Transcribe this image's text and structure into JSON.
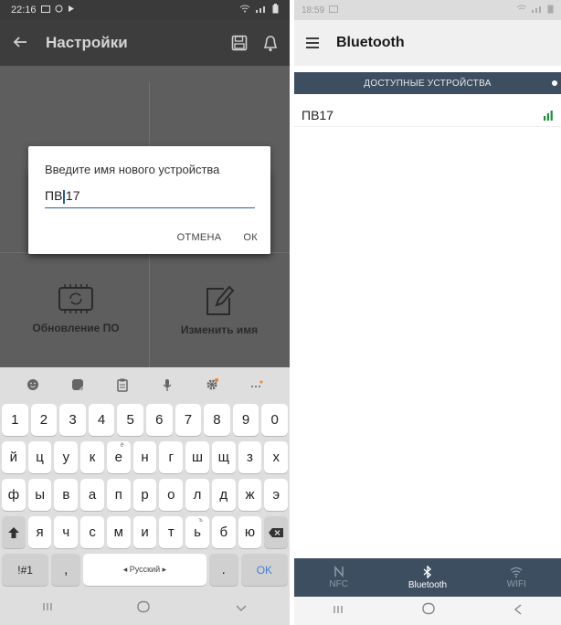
{
  "left": {
    "status": {
      "time": "22:16"
    },
    "appbar": {
      "title": "Настройки"
    },
    "dialog": {
      "title": "Введите имя нового устройства",
      "input_value_before_caret": "ПВ",
      "input_value_after_caret": "17",
      "cancel_label": "ОТМЕНА",
      "ok_label": "ОК"
    },
    "tiles": [
      {
        "label": "Обновление ПО",
        "icon": "firmware-chip-icon"
      },
      {
        "label": "Изменить имя",
        "icon": "edit-name-icon"
      }
    ],
    "keyboard": {
      "row_numbers": [
        "1",
        "2",
        "3",
        "4",
        "5",
        "6",
        "7",
        "8",
        "9",
        "0"
      ],
      "row1": [
        "й",
        "ц",
        "у",
        "к",
        "е",
        "н",
        "г",
        "ш",
        "щ",
        "з",
        "х"
      ],
      "row1_sup": {
        "4": "ё"
      },
      "row2": [
        "ф",
        "ы",
        "в",
        "а",
        "п",
        "р",
        "о",
        "л",
        "д",
        "ж",
        "э"
      ],
      "row3": [
        "я",
        "ч",
        "с",
        "м",
        "и",
        "т",
        "ь",
        "б",
        "ю"
      ],
      "row3_sup": {
        "6": "ъ"
      },
      "symbols_label": "!#1",
      "comma_label": ",",
      "space_label": "◂ Русский ▸",
      "period_label": ".",
      "ok_label": "OK"
    }
  },
  "right": {
    "status": {
      "time": "18:59"
    },
    "appbar": {
      "title": "Bluetooth"
    },
    "tab_label": "ДОСТУПНЫЕ УСТРОЙСТВА",
    "devices": [
      {
        "name": "ПВ17"
      }
    ],
    "bottom_nav": [
      {
        "label": "NFC",
        "active": false
      },
      {
        "label": "Bluetooth",
        "active": true
      },
      {
        "label": "WIFI",
        "active": false
      }
    ]
  },
  "colors": {
    "accent_blue": "#2a5aa8",
    "nav_dark": "#3e4e61",
    "signal_green": "#1f8f3a"
  }
}
